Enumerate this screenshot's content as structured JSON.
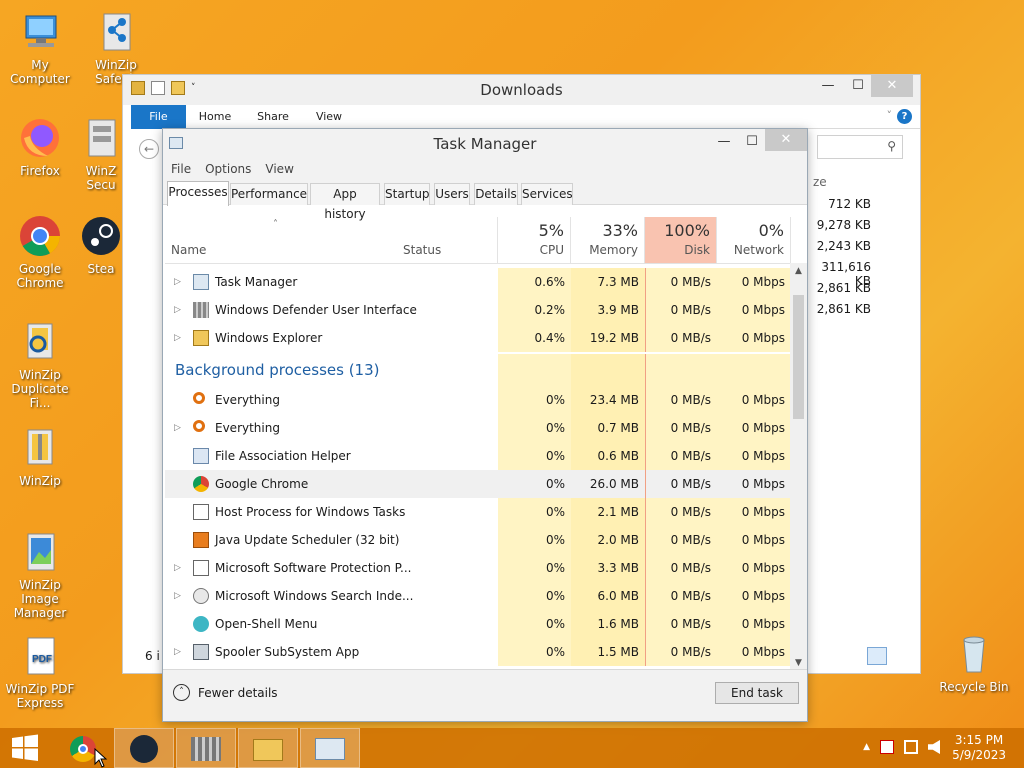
{
  "desktop": {
    "icons": [
      {
        "label": "My Computer",
        "icon": "my-computer-icon"
      },
      {
        "label": "Firefox",
        "icon": "firefox-icon"
      },
      {
        "label": "Google Chrome",
        "icon": "chrome-icon"
      },
      {
        "label": "WinZip Duplicate Fi...",
        "icon": "winzip-duplicate-icon"
      },
      {
        "label": "WinZip",
        "icon": "winzip-icon"
      },
      {
        "label": "WinZip Image Manager",
        "icon": "winzip-image-icon"
      },
      {
        "label": "WinZip PDF Express",
        "icon": "winzip-pdf-icon"
      },
      {
        "label": "WinZip SafeSh",
        "icon": "winzip-safeshare-icon"
      },
      {
        "label": "WinZ Secu",
        "icon": "winzip-security-icon"
      },
      {
        "label": "Stea",
        "icon": "steam-icon"
      },
      {
        "label": "Recycle Bin",
        "icon": "recycle-bin-icon"
      }
    ],
    "pdf_glyph": "PDF"
  },
  "explorer": {
    "title": "Downloads",
    "ribbon_tabs": [
      "File",
      "Home",
      "Share",
      "View"
    ],
    "size_header": "ze",
    "sizes": [
      "712 KB",
      "9,278 KB",
      "2,243 KB",
      "311,616 KB",
      "2,861 KB",
      "2,861 KB"
    ],
    "item_count": "6 i",
    "search_glyph": "⚲",
    "help_glyph": "?"
  },
  "taskmgr": {
    "title": "Task Manager",
    "menu": [
      "File",
      "Options",
      "View"
    ],
    "tabs": [
      "Processes",
      "Performance",
      "App history",
      "Startup",
      "Users",
      "Details",
      "Services"
    ],
    "columns": {
      "name": "Name",
      "status": "Status",
      "cpu": {
        "pct": "5%",
        "label": "CPU"
      },
      "memory": {
        "pct": "33%",
        "label": "Memory"
      },
      "disk": {
        "pct": "100%",
        "label": "Disk"
      },
      "network": {
        "pct": "0%",
        "label": "Network"
      }
    },
    "apps": [
      {
        "name": "Task Manager",
        "cpu": "0.6%",
        "mem": "7.3 MB",
        "disk": "0 MB/s",
        "net": "0 Mbps"
      },
      {
        "name": "Windows Defender User Interface",
        "cpu": "0.2%",
        "mem": "3.9 MB",
        "disk": "0 MB/s",
        "net": "0 Mbps"
      },
      {
        "name": "Windows Explorer",
        "cpu": "0.4%",
        "mem": "19.2 MB",
        "disk": "0 MB/s",
        "net": "0 Mbps"
      }
    ],
    "background_header": "Background processes (13)",
    "background": [
      {
        "name": "Everything",
        "cpu": "0%",
        "mem": "23.4 MB",
        "disk": "0 MB/s",
        "net": "0 Mbps"
      },
      {
        "name": "Everything",
        "cpu": "0%",
        "mem": "0.7 MB",
        "disk": "0 MB/s",
        "net": "0 Mbps"
      },
      {
        "name": "File Association Helper",
        "cpu": "0%",
        "mem": "0.6 MB",
        "disk": "0 MB/s",
        "net": "0 Mbps"
      },
      {
        "name": "Google Chrome",
        "cpu": "0%",
        "mem": "26.0 MB",
        "disk": "0 MB/s",
        "net": "0 Mbps"
      },
      {
        "name": "Host Process for Windows Tasks",
        "cpu": "0%",
        "mem": "2.1 MB",
        "disk": "0 MB/s",
        "net": "0 Mbps"
      },
      {
        "name": "Java Update Scheduler (32 bit)",
        "cpu": "0%",
        "mem": "2.0 MB",
        "disk": "0 MB/s",
        "net": "0 Mbps"
      },
      {
        "name": "Microsoft Software Protection P...",
        "cpu": "0%",
        "mem": "3.3 MB",
        "disk": "0 MB/s",
        "net": "0 Mbps"
      },
      {
        "name": "Microsoft Windows Search Inde...",
        "cpu": "0%",
        "mem": "6.0 MB",
        "disk": "0 MB/s",
        "net": "0 Mbps"
      },
      {
        "name": "Open-Shell Menu",
        "cpu": "0%",
        "mem": "1.6 MB",
        "disk": "0 MB/s",
        "net": "0 Mbps"
      },
      {
        "name": "Spooler SubSystem App",
        "cpu": "0%",
        "mem": "1.5 MB",
        "disk": "0 MB/s",
        "net": "0 Mbps"
      }
    ],
    "fewer_details": "Fewer details",
    "end_task": "End task"
  },
  "taskbar": {
    "time": "3:15 PM",
    "date": "5/9/2023"
  },
  "glyphs": {
    "minimize": "—",
    "maximize": "☐",
    "close": "✕",
    "collapse_up": "˄",
    "scroll_up": "▲",
    "scroll_down": "▼",
    "tray_chevron": "▲",
    "ribbon_expand": "˅",
    "back_arrow": "←",
    "sort_caret": "˄"
  },
  "colors": {
    "accent": "#1a76c8",
    "section_header": "#1f5fa3",
    "disk_header_bg": "#f9c3b0",
    "heat_cell": "#fff4c4"
  }
}
